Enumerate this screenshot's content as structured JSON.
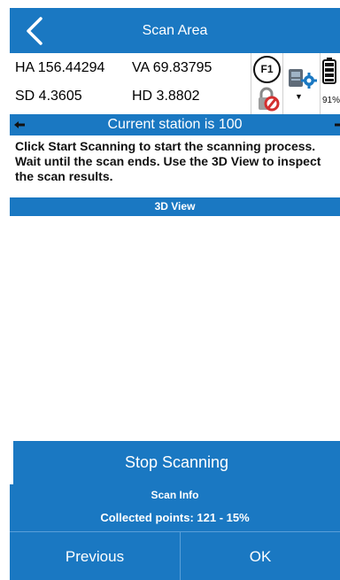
{
  "header": {
    "title": "Scan Area",
    "back_icon": "chevron-left-icon"
  },
  "measurements": {
    "ha": "HA 156.44294",
    "va": "VA 69.83795",
    "sd": "SD 4.3605",
    "hd": "HD 3.8802"
  },
  "status_icons": {
    "f1_label": "F1",
    "lock_icon": "lock-error-icon",
    "device_icon": "instrument-settings-icon",
    "battery_icon": "battery-icon",
    "battery_level": "91%"
  },
  "station": {
    "text": "Current station is 100"
  },
  "instructions": "Click Start Scanning to start the scanning process. Wait until the scan ends. Use the 3D View to inspect the scan results.",
  "view": {
    "title": "3D View"
  },
  "actions": {
    "stop_label": "Stop Scanning"
  },
  "scan_info": {
    "title": "Scan Info",
    "points": "Collected points: 121 - 15%"
  },
  "footer": {
    "previous_label": "Previous",
    "ok_label": "OK"
  },
  "colors": {
    "primary": "#1a78c2",
    "accent_error": "#d32f2f"
  }
}
